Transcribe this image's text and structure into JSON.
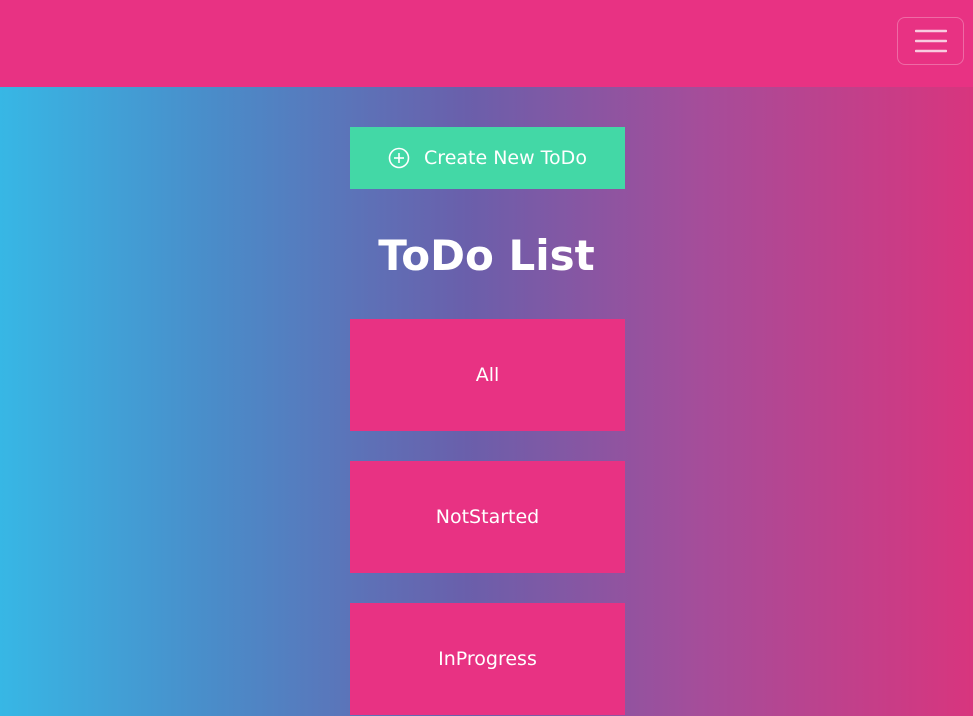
{
  "navbar": {
    "toggle_icon": "hamburger-menu-icon",
    "color": "#e83283"
  },
  "create_button": {
    "label": "Create New ToDo",
    "icon": "plus-circle-icon",
    "color": "#43d8a6"
  },
  "page_title": "ToDo List",
  "filters": [
    {
      "label": "All"
    },
    {
      "label": "NotStarted"
    },
    {
      "label": "InProgress"
    }
  ],
  "colors": {
    "gradient_left": "#37b7e5",
    "gradient_mid": "#6a5fab",
    "gradient_right": "#d8357e",
    "filter_button": "#e83283"
  }
}
